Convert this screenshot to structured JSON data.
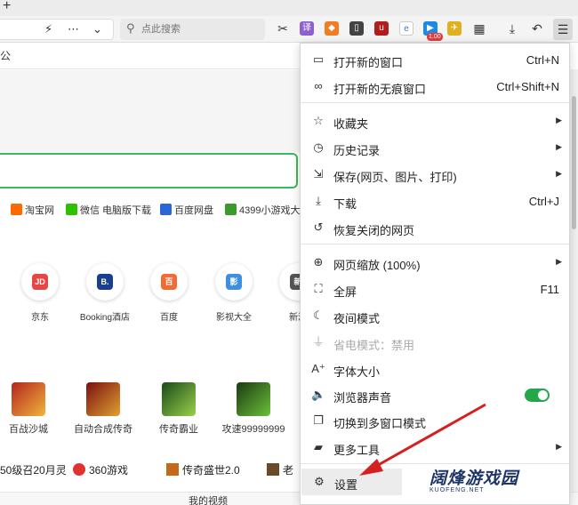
{
  "toolbar": {
    "search_placeholder": "点此搜索",
    "badge_count": "1.00"
  },
  "page": {
    "subline_text": "公",
    "quick_links": [
      "淘宝网",
      "微信 电脑版下载",
      "百度网盘",
      "4399小游戏大"
    ],
    "sites": [
      {
        "label": "京东",
        "logo": "JD"
      },
      {
        "label": "Booking酒店",
        "logo": "B."
      },
      {
        "label": "百度",
        "logo": "百"
      },
      {
        "label": "影视大全",
        "logo": "影"
      },
      {
        "label": "新浪",
        "logo": "新"
      }
    ],
    "games": [
      "百战沙城",
      "自动合成传奇",
      "传奇霸业",
      "攻速99999999"
    ],
    "bottom_links": [
      "50级召20月灵",
      "360游戏",
      "传奇盛世2.0",
      "老"
    ],
    "footer_text": "我的视频"
  },
  "menu": {
    "items": [
      {
        "label": "打开新的窗口",
        "shortcut": "Ctrl+N",
        "icon": "window-icon"
      },
      {
        "label": "打开新的无痕窗口",
        "shortcut": "Ctrl+Shift+N",
        "icon": "incognito-icon"
      },
      {
        "label": "收藏夹",
        "icon": "star-icon"
      },
      {
        "label": "历史记录",
        "icon": "history-icon"
      },
      {
        "label": "保存(网页、图片、打印)",
        "icon": "save-icon"
      },
      {
        "label": "下载",
        "shortcut": "Ctrl+J",
        "icon": "download-icon"
      },
      {
        "label": "恢复关闭的网页",
        "icon": "restore-icon"
      },
      {
        "label": "网页缩放 (100%)",
        "icon": "zoom-icon"
      },
      {
        "label": "全屏",
        "shortcut": "F11",
        "icon": "fullscreen-icon"
      },
      {
        "label": "夜间模式",
        "icon": "moon-icon"
      },
      {
        "label": "省电模式：禁用",
        "icon": "plug-icon"
      },
      {
        "label": "字体大小",
        "icon": "font-size-icon"
      },
      {
        "label": "浏览器声音",
        "icon": "speaker-icon"
      },
      {
        "label": "切换到多窗口模式",
        "icon": "multi-window-icon"
      },
      {
        "label": "更多工具",
        "icon": "toolbox-icon"
      },
      {
        "label": "设置",
        "icon": "gear-icon"
      }
    ]
  },
  "watermark": {
    "title": "阔烽游戏园",
    "subtitle": "KUOFENG.NET"
  },
  "colors": {
    "accent_green": "#22a849",
    "arrow_red": "#d62020"
  }
}
